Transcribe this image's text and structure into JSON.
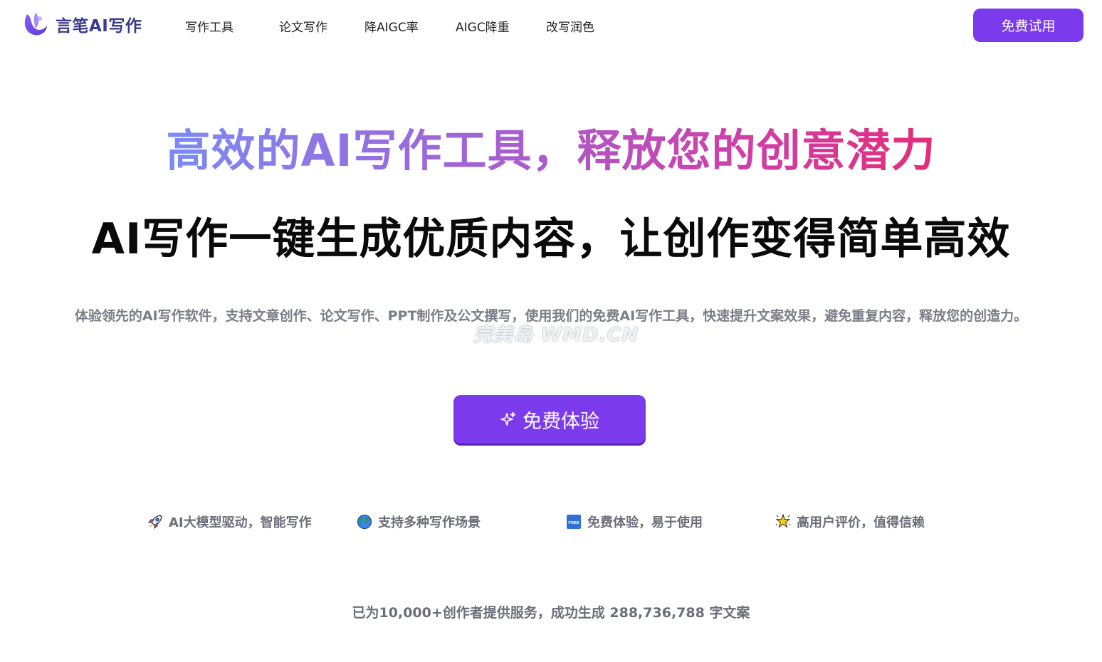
{
  "header": {
    "logo_text": "言笔AI写作",
    "nav": [
      {
        "label": "写作工具"
      },
      {
        "label": "论文写作"
      },
      {
        "label": "降AIGC率"
      },
      {
        "label": "AIGC降重"
      },
      {
        "label": "改写润色"
      }
    ],
    "cta_label": "免费试用"
  },
  "hero": {
    "headline": "高效的AI写作工具，释放您的创意潜力",
    "subheadline": "AI写作一键生成优质内容，让创作变得简单高效",
    "description": "体验领先的AI写作软件，支持文章创作、论文写作、PPT制作及公文撰写，使用我们的免费AI写作工具，快速提升文案效果，避免重复内容，释放您的创造力。",
    "cta_label": "免费体验",
    "watermark": "完美岛 WMD.CN"
  },
  "features": [
    {
      "icon": "rocket-icon",
      "label": "AI大模型驱动，智能写作"
    },
    {
      "icon": "globe-icon",
      "label": "支持多种写作场景"
    },
    {
      "icon": "free-badge-icon",
      "label": "免费体验，易于使用"
    },
    {
      "icon": "star-icon",
      "label": "高用户评价，值得信赖"
    }
  ],
  "stats": "已为10,000+创作者提供服务，成功生成 288,736,788 字文案",
  "colors": {
    "accent": "#7c3aed",
    "gradient_start": "#7b8bf4",
    "gradient_end": "#e32d78",
    "muted_text": "#6b6d78"
  }
}
